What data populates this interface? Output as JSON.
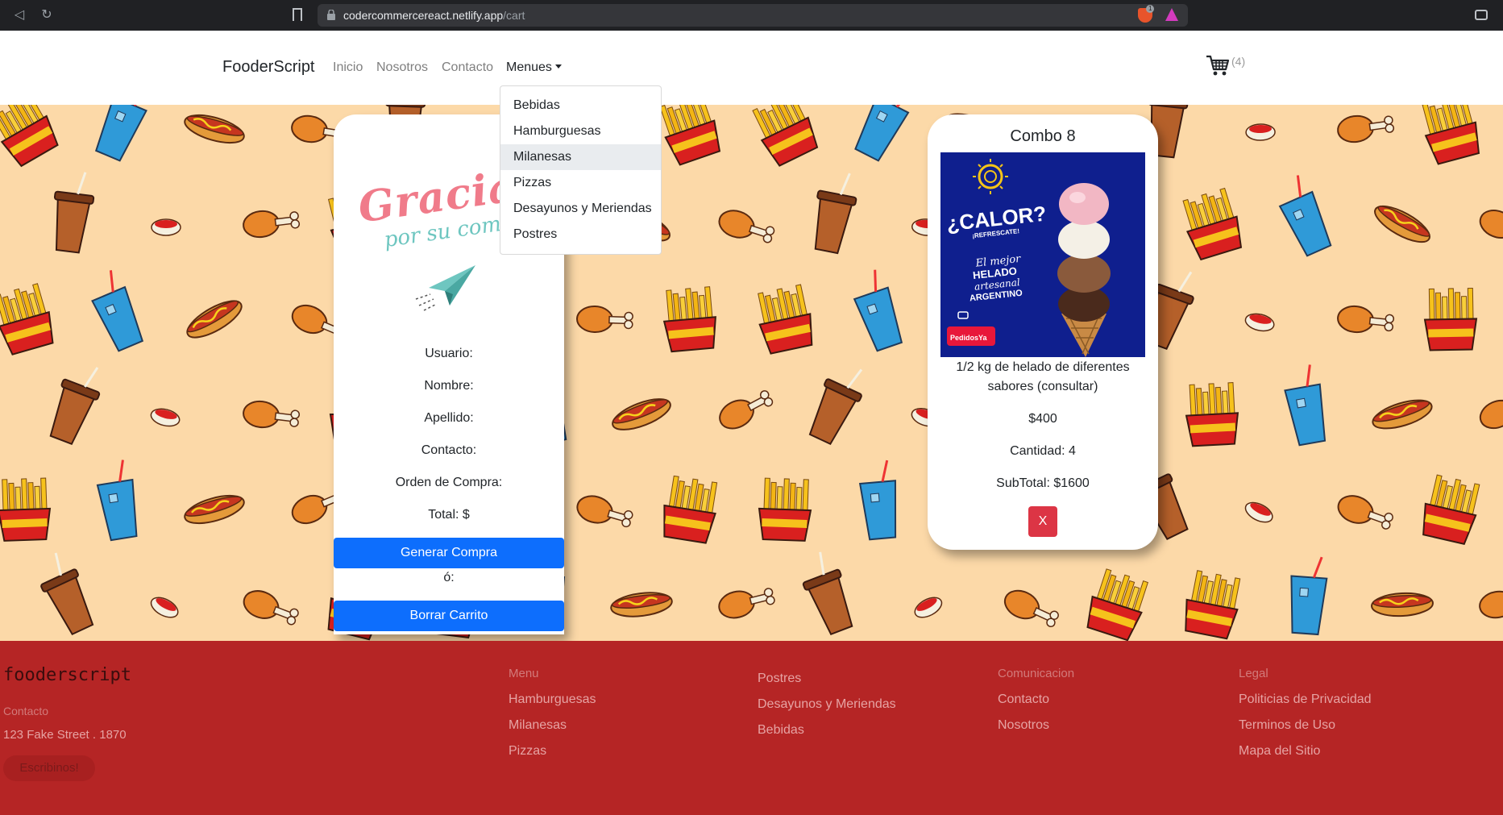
{
  "browser": {
    "url_domain": "codercommercereact.netlify.app",
    "url_path": "/cart"
  },
  "navbar": {
    "brand": "FooderScript",
    "links": [
      "Inicio",
      "Nosotros",
      "Contacto"
    ],
    "menu_label": "Menues",
    "cart_count": "(4)"
  },
  "dropdown": {
    "items": [
      "Bebidas",
      "Hamburguesas",
      "Milanesas",
      "Pizzas",
      "Desayunos y Meriendas",
      "Postres"
    ],
    "active_item": "Milanesas"
  },
  "checkout": {
    "banner_title": "Gracias",
    "banner_subtitle": "por su compra",
    "fields": [
      "Usuario:",
      "Nombre:",
      "Apellido:",
      "Contacto:",
      "Orden de Compra:",
      "Total: $"
    ],
    "generate_button": "Generar Compra",
    "separator": "ó:",
    "clear_button": "Borrar Carrito"
  },
  "product": {
    "title": "Combo 8",
    "image_text": {
      "headline": "¿CALOR?",
      "subheadline": "¡REFRESCATE!",
      "line1": "El mejor",
      "line2": "HELADO",
      "line3": "artesanal",
      "line4": "ARGENTINO",
      "brand": "PedidosYa"
    },
    "description": "1/2 kg de helado de diferentes sabores (consultar)",
    "price": "$400",
    "quantity": "Cantidad: 4",
    "subtotal": "SubTotal: $1600",
    "remove_button": "X"
  },
  "footer": {
    "brand": "fooderscript",
    "contact_label": "Contacto",
    "address": "123 Fake Street . 1870",
    "write_button": "Escribinos!",
    "col1": {
      "heading": "Menu",
      "links": [
        "Hamburguesas",
        "Milanesas",
        "Pizzas"
      ]
    },
    "col2": {
      "links": [
        "Postres",
        "Desayunos y Meriendas",
        "Bebidas"
      ]
    },
    "col3": {
      "heading": "Comunicacion",
      "links": [
        "Contacto",
        "Nosotros"
      ]
    },
    "col4": {
      "heading": "Legal",
      "links": [
        "Politicias de Privacidad",
        "Terminos de Uso",
        "Mapa del Sitio"
      ]
    }
  },
  "colors": {
    "primary_button": "#0d6efd",
    "danger_button": "#dc3545",
    "footer_bg": "#b52525",
    "pattern_bg": "#fcd9a8"
  }
}
